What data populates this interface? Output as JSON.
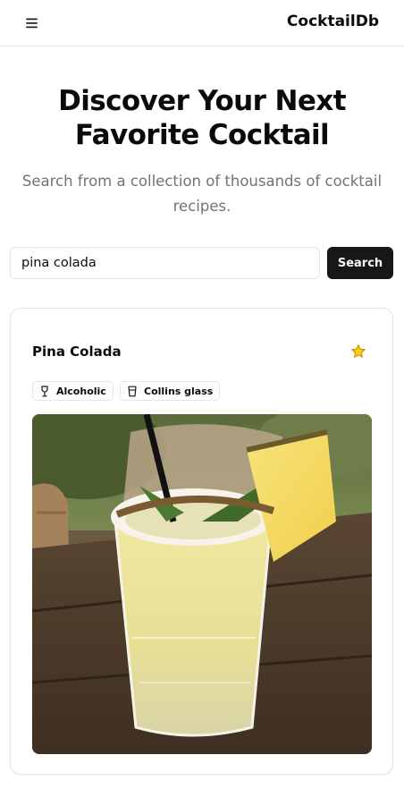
{
  "header": {
    "brand": "CocktailDb",
    "menu_icon": "hamburger-menu-icon"
  },
  "hero": {
    "title": "Discover Your Next Favorite Cocktail",
    "subtitle": "Search from a collection of thousands of cocktail recipes."
  },
  "search": {
    "value": "pina colada",
    "button_label": "Search"
  },
  "results": [
    {
      "name": "Pina Colada",
      "favorite": true,
      "favorite_icon": "star-icon",
      "favorite_color": "#facc15",
      "badges": [
        {
          "label": "Alcoholic",
          "icon": "wine-glass-icon"
        },
        {
          "label": "Collins glass",
          "icon": "tumbler-glass-icon"
        }
      ],
      "image": "cocktail-photo"
    }
  ],
  "colors": {
    "primary_button": "#171717",
    "muted_text": "#737373",
    "border": "#e5e5e5"
  }
}
